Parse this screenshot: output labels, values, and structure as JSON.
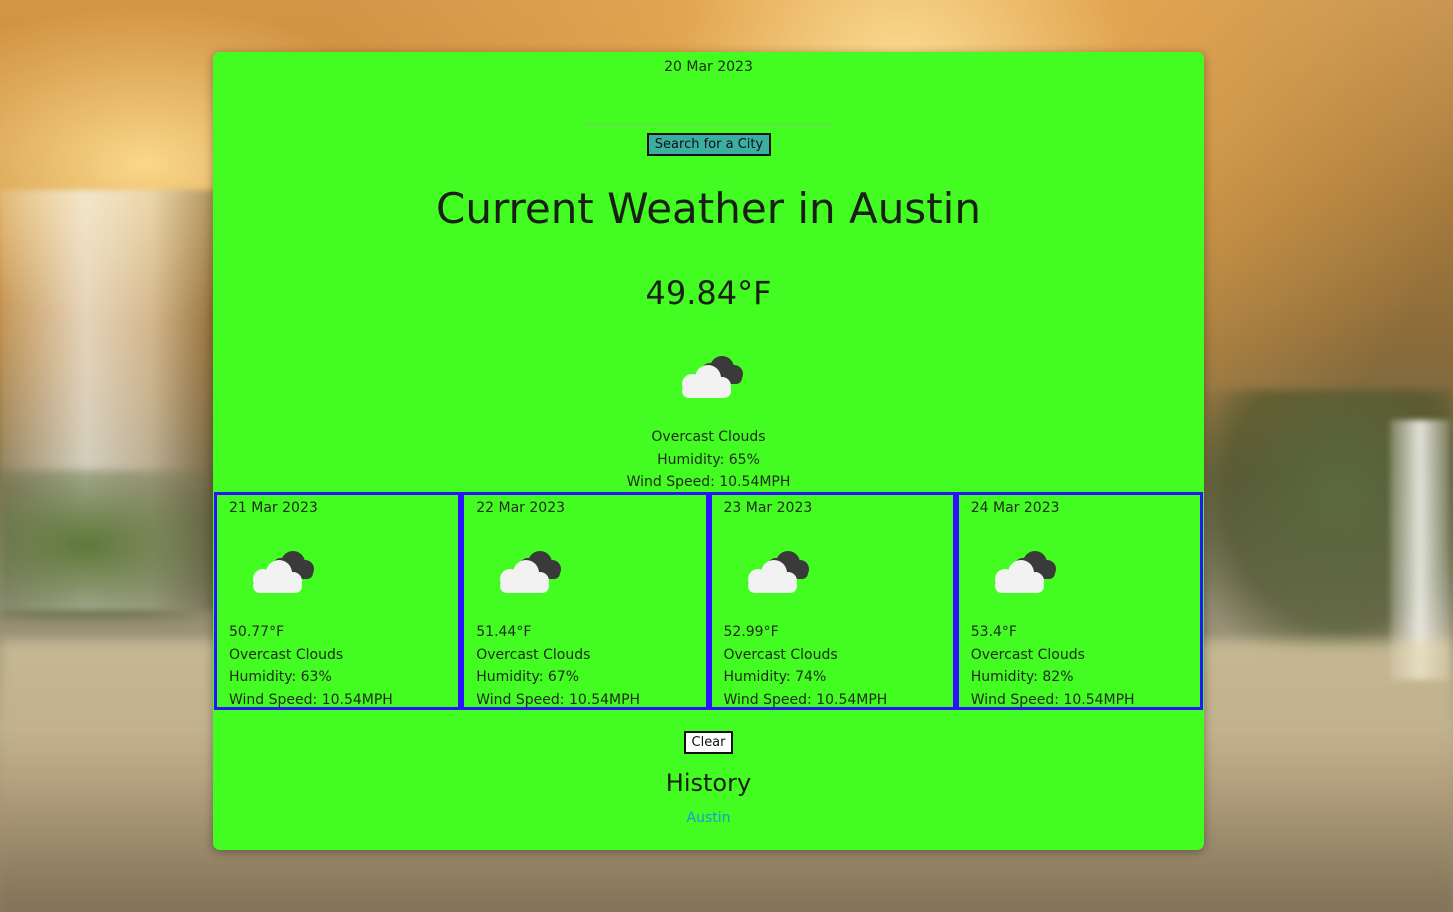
{
  "current": {
    "date": "20 Mar 2023",
    "search_placeholder": "",
    "search_button_label": "Search for a City",
    "title": "Current Weather in Austin",
    "temperature": "49.84°F",
    "icon": "overcast-clouds-icon",
    "description": "Overcast Clouds",
    "humidity": "Humidity: 65%",
    "wind": "Wind Speed: 10.54MPH"
  },
  "forecast": [
    {
      "date": "21 Mar 2023",
      "icon": "overcast-clouds-icon",
      "temperature": "50.77°F",
      "description": "Overcast Clouds",
      "humidity": "Humidity: 63%",
      "wind": "Wind Speed: 10.54MPH"
    },
    {
      "date": "22 Mar 2023",
      "icon": "overcast-clouds-icon",
      "temperature": "51.44°F",
      "description": "Overcast Clouds",
      "humidity": "Humidity: 67%",
      "wind": "Wind Speed: 10.54MPH"
    },
    {
      "date": "23 Mar 2023",
      "icon": "overcast-clouds-icon",
      "temperature": "52.99°F",
      "description": "Overcast Clouds",
      "humidity": "Humidity: 74%",
      "wind": "Wind Speed: 10.54MPH"
    },
    {
      "date": "24 Mar 2023",
      "icon": "overcast-clouds-icon",
      "temperature": "53.4°F",
      "description": "Overcast Clouds",
      "humidity": "Humidity: 82%",
      "wind": "Wind Speed: 10.54MPH"
    }
  ],
  "clear_button_label": "Clear",
  "history": {
    "title": "History",
    "items": [
      "Austin"
    ]
  },
  "colors": {
    "card_background": "#43fc22",
    "forecast_border": "#2a12ff",
    "search_button": "#3aaea0",
    "history_link": "#1d9ad6"
  }
}
